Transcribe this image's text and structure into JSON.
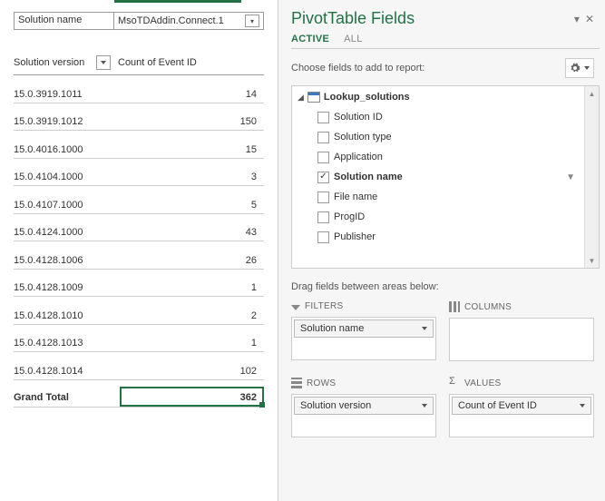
{
  "pivot": {
    "filter_field_label": "Solution name",
    "filter_value": "MsoTDAddin.Connect.1",
    "headers": {
      "col1": "Solution version",
      "col2": "Count of Event ID"
    },
    "rows": [
      {
        "version": "15.0.3919.1011",
        "count": 14
      },
      {
        "version": "15.0.3919.1012",
        "count": 150
      },
      {
        "version": "15.0.4016.1000",
        "count": 15
      },
      {
        "version": "15.0.4104.1000",
        "count": 3
      },
      {
        "version": "15.0.4107.1000",
        "count": 5
      },
      {
        "version": "15.0.4124.1000",
        "count": 43
      },
      {
        "version": "15.0.4128.1006",
        "count": 26
      },
      {
        "version": "15.0.4128.1009",
        "count": 1
      },
      {
        "version": "15.0.4128.1010",
        "count": 2
      },
      {
        "version": "15.0.4128.1013",
        "count": 1
      },
      {
        "version": "15.0.4128.1014",
        "count": 102
      }
    ],
    "total_label": "Grand Total",
    "total_value": 362
  },
  "fields_pane": {
    "title": "PivotTable Fields",
    "tabs": {
      "active": "ACTIVE",
      "all": "ALL"
    },
    "prompt": "Choose fields to add to report:",
    "table_name": "Lookup_solutions",
    "fields": [
      {
        "label": "Solution ID",
        "checked": false,
        "filter": false
      },
      {
        "label": "Solution type",
        "checked": false,
        "filter": false
      },
      {
        "label": "Application",
        "checked": false,
        "filter": false
      },
      {
        "label": "Solution name",
        "checked": true,
        "filter": true
      },
      {
        "label": "File name",
        "checked": false,
        "filter": false
      },
      {
        "label": "ProgID",
        "checked": false,
        "filter": false
      },
      {
        "label": "Publisher",
        "checked": false,
        "filter": false
      }
    ],
    "drag_label": "Drag fields between areas below:",
    "areas": {
      "filters": {
        "header": "FILTERS",
        "item": "Solution name"
      },
      "columns": {
        "header": "COLUMNS",
        "item": null
      },
      "rows": {
        "header": "ROWS",
        "item": "Solution version"
      },
      "values": {
        "header": "VALUES",
        "item": "Count of Event ID"
      }
    }
  }
}
